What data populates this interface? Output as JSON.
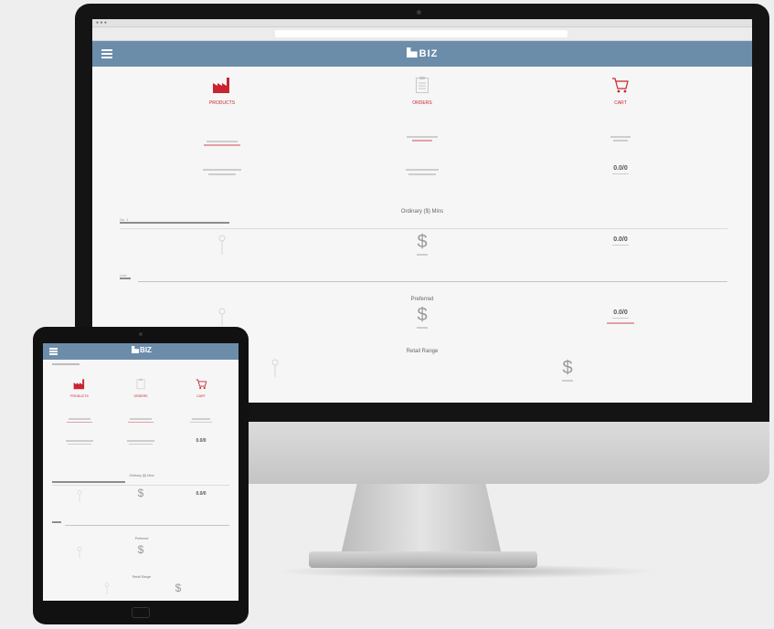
{
  "app": {
    "logo_text": "BIZ",
    "colors": {
      "header": "#6c8daa",
      "accent": "#c9242f",
      "screen_bg": "#f6f6f6"
    }
  },
  "desktop": {
    "nav": [
      {
        "icon": "factory-icon",
        "label": "PRODUCTS",
        "active": true
      },
      {
        "icon": "clipboard-icon",
        "label": "ORDERS",
        "active": false
      },
      {
        "icon": "cart-icon",
        "label": "CART",
        "active": false
      }
    ],
    "sections": {
      "ordinary_title": "Ordinary ($) Mins",
      "preferred_title": "Preferred",
      "retail_title": "Retail Range"
    },
    "big_counts": {
      "a": "0.0/0",
      "b": "0.0/0",
      "c": "0.0/0",
      "d": "0.0/0"
    },
    "field_labels": {
      "top_left": "No. 1",
      "dropdown": "Line"
    }
  },
  "tablet": {
    "nav": [
      {
        "icon": "factory-icon",
        "label": "PRODUCTS"
      },
      {
        "icon": "clipboard-icon",
        "label": "ORDERS"
      },
      {
        "icon": "cart-icon",
        "label": "CART"
      }
    ],
    "big_counts": {
      "a": "0.0/0",
      "b": "0.0/0"
    },
    "sections": {
      "ordinary_title": "Ordinary ($) Mins",
      "preferred_title": "Preferred",
      "retail_title": "Retail Range"
    }
  }
}
